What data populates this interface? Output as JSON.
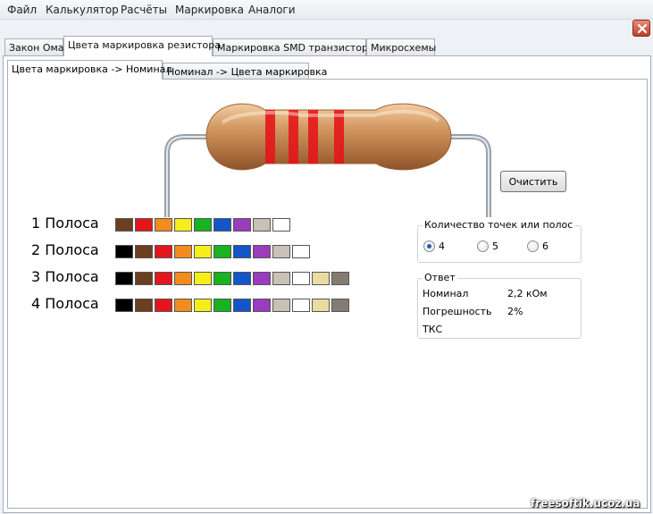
{
  "menu": [
    "Файл",
    "Калькулятор",
    "Расчёты",
    "Маркировка",
    "Аналоги"
  ],
  "tabs": [
    "Закон Ома",
    "Цвета маркировка резистора",
    "Маркировка SMD транзисторов",
    "Микросхемы"
  ],
  "subtabs": [
    "Цвета маркировка -> Номинал",
    "Номинал -> Цвета маркировка"
  ],
  "bands": {
    "row1_label": "1 Полоса",
    "row2_label": "2 Полоса",
    "row3_label": "3 Полоса",
    "row4_label": "4 Полоса",
    "row1_colors": [
      "#6b3f1f",
      "#e4161b",
      "#f28c1e",
      "#f6ee1a",
      "#17b320",
      "#1455c8",
      "#9b3bbd",
      "#c9c0b6",
      "#ffffff"
    ],
    "row2_colors": [
      "#000000",
      "#6b3f1f",
      "#e4161b",
      "#f28c1e",
      "#f6ee1a",
      "#17b320",
      "#1455c8",
      "#9b3bbd",
      "#c9c0b6",
      "#ffffff"
    ],
    "row3_colors": [
      "#000000",
      "#6b3f1f",
      "#e4161b",
      "#f28c1e",
      "#f6ee1a",
      "#17b320",
      "#1455c8",
      "#9b3bbd",
      "#c9c0b6",
      "#ffffff",
      "#eadba0",
      "#847c73"
    ],
    "row4_colors": [
      "#000000",
      "#6b3f1f",
      "#e4161b",
      "#f28c1e",
      "#f6ee1a",
      "#17b320",
      "#1455c8",
      "#9b3bbd",
      "#c9c0b6",
      "#ffffff",
      "#eadba0",
      "#847c73"
    ]
  },
  "resistor": {
    "body_color": "#d49a63",
    "band_colors": [
      "#e4161b",
      "#e4161b",
      "#e4161b",
      "#e4161b"
    ]
  },
  "clear_button": "Очистить",
  "band_count": {
    "title": "Количество точек или полос",
    "options": [
      "4",
      "5",
      "6"
    ],
    "selected": "4"
  },
  "answer": {
    "title": "Ответ",
    "nominal_label": "Номинал",
    "nominal_value": "2,2 кОм",
    "tolerance_label": "Погрешность",
    "tolerance_value": "2%",
    "tks_label": "ТКС"
  },
  "watermark": "freesoftik.ucoz.ua"
}
